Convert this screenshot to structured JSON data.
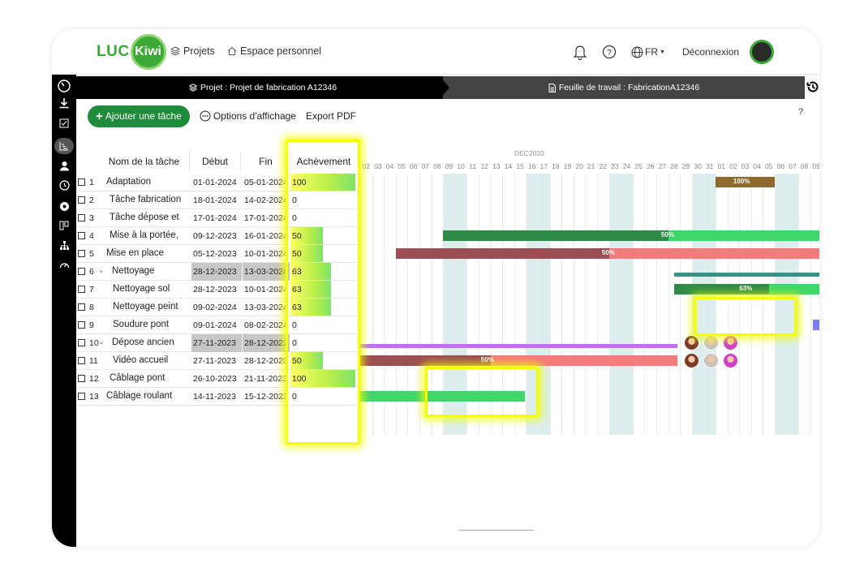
{
  "header": {
    "logo_left": "LUC",
    "logo_right": "Kiwi",
    "nav": [
      {
        "label": "Projets",
        "icon": "layers-icon"
      },
      {
        "label": "Espace personnel",
        "icon": "home-icon"
      }
    ],
    "language": "FR",
    "logout_label": "Déconnexion"
  },
  "breadcrumb": {
    "project": "Projet : Projet de fabrication A12346",
    "worksheet": "Feuille de travail : FabricationA12346"
  },
  "toolbar": {
    "add_task": "Ajouter une tâche",
    "display_options": "Options d'affichage",
    "export_pdf": "Export PDF",
    "help": "?"
  },
  "table": {
    "headers": {
      "name": "Nom de la tâche",
      "start": "Début",
      "end": "Fin",
      "achievement": "Achèvement"
    },
    "rows": [
      {
        "num": "1",
        "name": "Adaptation",
        "start": "01-01-2024",
        "end": "05-01-2024",
        "achievement": "100",
        "pct": 100,
        "indent": 0,
        "group": false
      },
      {
        "num": "2",
        "name": "Tâche fabrication",
        "start": "18-01-2024",
        "end": "14-02-2024",
        "achievement": "0",
        "pct": 0,
        "indent": 1,
        "group": false
      },
      {
        "num": "3",
        "name": "Tâche dépose et",
        "start": "17-01-2024",
        "end": "17-01-2024",
        "achievement": "0",
        "pct": 0,
        "indent": 1,
        "group": false
      },
      {
        "num": "4",
        "name": "Mise à la portée,",
        "start": "09-12-2023",
        "end": "16-01-2024",
        "achievement": "50",
        "pct": 50,
        "indent": 1,
        "group": false
      },
      {
        "num": "5",
        "name": "Mise en place",
        "start": "05-12-2023",
        "end": "10-01-2024",
        "achievement": "50",
        "pct": 50,
        "indent": 0,
        "group": false
      },
      {
        "num": "6",
        "name": "Nettoyage",
        "start": "28-12-2023",
        "end": "13-03-2024",
        "achievement": "63",
        "pct": 63,
        "indent": 0,
        "group": true
      },
      {
        "num": "7",
        "name": "Nettoyage sol",
        "start": "28-12-2023",
        "end": "10-01-2024",
        "achievement": "63",
        "pct": 63,
        "indent": 2,
        "group": false
      },
      {
        "num": "8",
        "name": "Nettoyage peint",
        "start": "09-02-2024",
        "end": "13-03-2024",
        "achievement": "63",
        "pct": 63,
        "indent": 2,
        "group": false
      },
      {
        "num": "9",
        "name": "Soudure pont",
        "start": "09-01-2024",
        "end": "08-02-2024",
        "achievement": "0",
        "pct": 0,
        "indent": 2,
        "group": false
      },
      {
        "num": "10",
        "name": "Dépose ancien",
        "start": "27-11-2023",
        "end": "28-12-2023",
        "achievement": "0",
        "pct": 0,
        "indent": 0,
        "group": true
      },
      {
        "num": "11",
        "name": "Vidéo accueil",
        "start": "27-11-2023",
        "end": "28-12-2023",
        "achievement": "50",
        "pct": 50,
        "indent": 2,
        "group": false
      },
      {
        "num": "12",
        "name": "Câblage pont",
        "start": "26-10-2023",
        "end": "21-11-2023",
        "achievement": "100",
        "pct": 100,
        "indent": 1,
        "group": false
      },
      {
        "num": "13",
        "name": "Câblage roulant",
        "start": "14-11-2023",
        "end": "15-12-2023",
        "achievement": "0",
        "pct": 0,
        "indent": 0,
        "group": false
      }
    ]
  },
  "gantt": {
    "month": "DEC2023",
    "days": [
      "02",
      "03",
      "04",
      "05",
      "06",
      "07",
      "08",
      "09",
      "10",
      "11",
      "12",
      "13",
      "14",
      "15",
      "16",
      "17",
      "18",
      "19",
      "20",
      "21",
      "22",
      "23",
      "24",
      "25",
      "26",
      "27",
      "28",
      "29",
      "30",
      "31",
      "01",
      "02",
      "03",
      "04",
      "05",
      "06",
      "07",
      "08",
      "09"
    ],
    "bar_labels": {
      "row1": "100%",
      "row4": "50%",
      "row5": "50%",
      "row7": "63%",
      "row11": "50%"
    },
    "colors": {
      "brown": "#8f6a2e",
      "dark_green": "#2e8b47",
      "light_green": "#3fd66a",
      "dark_red": "#9c4e52",
      "salmon": "#f47b7b",
      "teal": "#3c8f86",
      "purple": "#c070f0",
      "blue": "#7c7ff0"
    }
  }
}
